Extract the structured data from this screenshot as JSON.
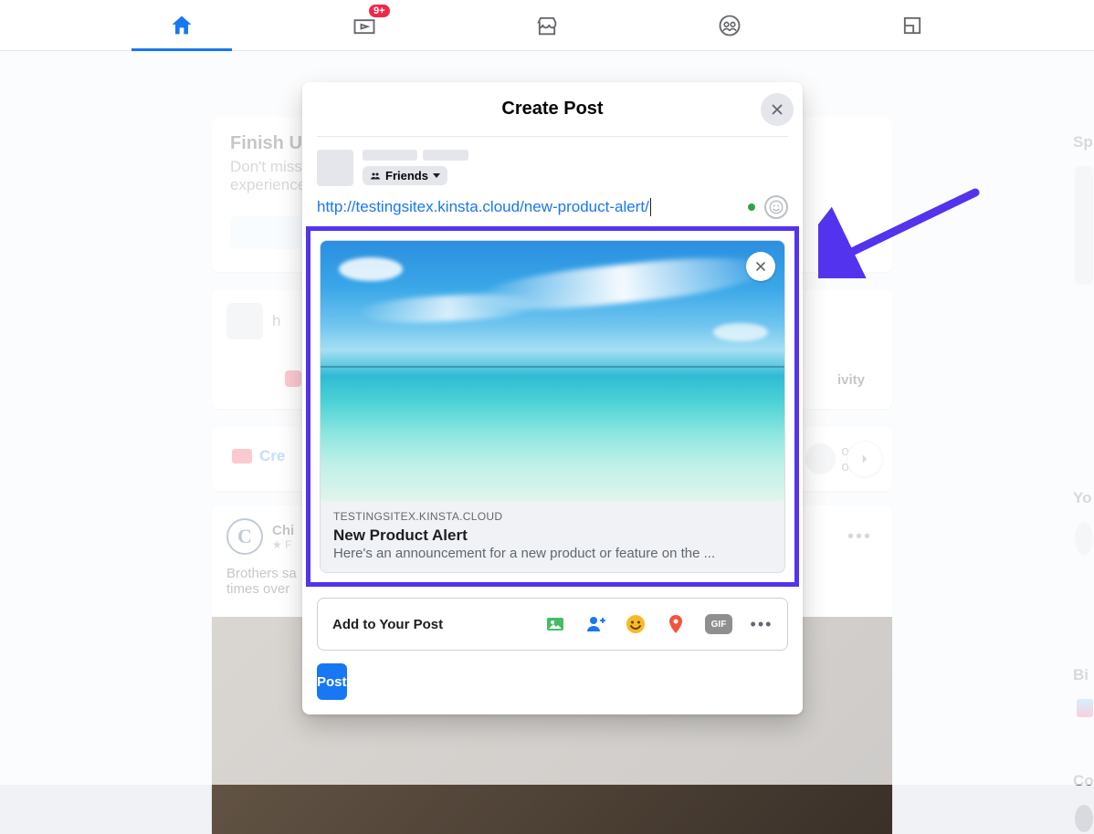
{
  "nav": {
    "badge": "9+"
  },
  "feed": {
    "card1_title": "Finish U",
    "card1_line1": "Don't miss",
    "card1_line2": "experience",
    "card2_compose_initial": "h",
    "card2_activity": "ivity",
    "create_btn": "Cre",
    "card3_source": "Chi",
    "card3_sub": "F",
    "card3_line1": "Brothers sa",
    "card3_line2": "times over",
    "story_fragment": "ozens of"
  },
  "rightcol": {
    "sponsored": "Sp",
    "your": "Yo",
    "birthdays": "Bi",
    "contacts": "Co"
  },
  "modal": {
    "title": "Create Post",
    "audience_label": "Friends",
    "compose_url": "http://testingsitex.kinsta.cloud/new-product-alert/",
    "preview": {
      "domain": "TESTINGSITEX.KINSTA.CLOUD",
      "title": "New Product Alert",
      "description": "Here's an announcement for a new product or feature on the ..."
    },
    "addto_label": "Add to Your Post",
    "gif_label": "GIF",
    "post_label": "Post"
  }
}
